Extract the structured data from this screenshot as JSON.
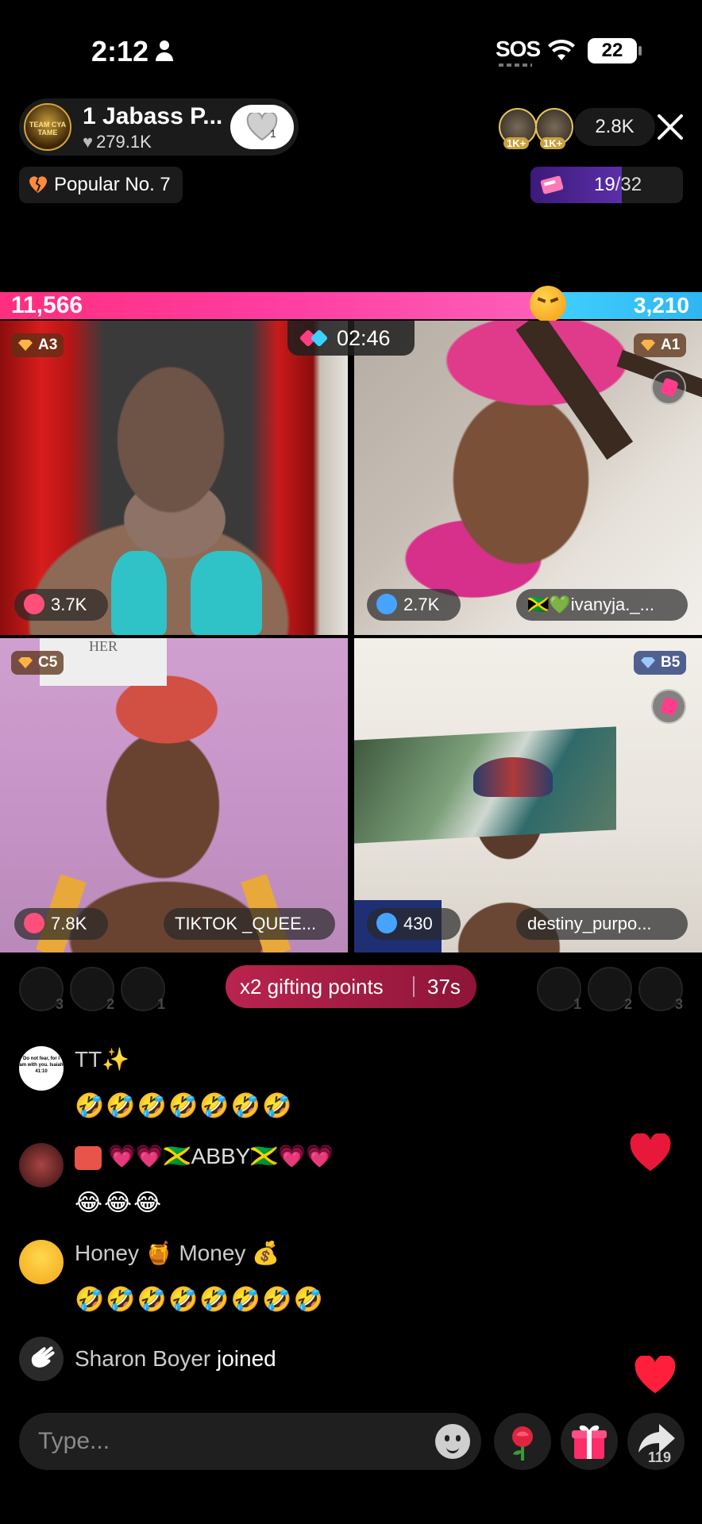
{
  "status_bar": {
    "time": "2:12",
    "sos": "SOS",
    "battery": "22"
  },
  "host": {
    "name": "1 Jabass P...",
    "likes": "279.1K",
    "avatar_text": "TEAM CYA TAME",
    "follow_count": "1"
  },
  "viewers": {
    "badge1": "1K+",
    "badge2": "1K+",
    "count": "2.8K"
  },
  "popular": {
    "label": "Popular No. 7"
  },
  "rank": {
    "current": "19",
    "total": "/32",
    "fill_fraction": 0.6
  },
  "battle": {
    "left_score": "11,566",
    "right_score": "3,210",
    "left_fraction": 0.78
  },
  "timer": "02:46",
  "tiles": [
    {
      "rank": "A3",
      "points": "3.7K",
      "name": ""
    },
    {
      "rank": "A1",
      "points": "2.7K",
      "name": "🇯🇲💚ivanyja._..."
    },
    {
      "rank": "C5",
      "points": "7.8K",
      "name": "TIKTOK _QUEE..."
    },
    {
      "rank": "B5",
      "points": "430",
      "name": "destiny_purpo..."
    }
  ],
  "tile3_sign": "HER",
  "gift_row": {
    "label": "x2 gifting points",
    "time": "37s",
    "left_ranks": [
      "3",
      "2",
      "1"
    ],
    "right_ranks": [
      "1",
      "2",
      "3"
    ]
  },
  "chat": [
    {
      "user": "TT✨",
      "text": "🤣🤣🤣🤣🤣🤣🤣",
      "avatar_text": "Do not fear, for I am with you. Isaiah 41:10"
    },
    {
      "user": "💗💗🇯🇲ABBY🇯🇲💗💗",
      "text": "😂😂😂"
    },
    {
      "user": "Honey 🍯 Money 💰",
      "text": "🤣🤣🤣🤣🤣🤣🤣🤣"
    },
    {
      "user": "Sharon Boyer",
      "action": "joined"
    }
  ],
  "bottom": {
    "placeholder": "Type...",
    "share_count": "119"
  },
  "colors": {
    "battle_left": "#ff2e7e",
    "battle_right": "#3fd0ff",
    "gift_pill": "#b9244e",
    "heart": "#e8183a"
  }
}
